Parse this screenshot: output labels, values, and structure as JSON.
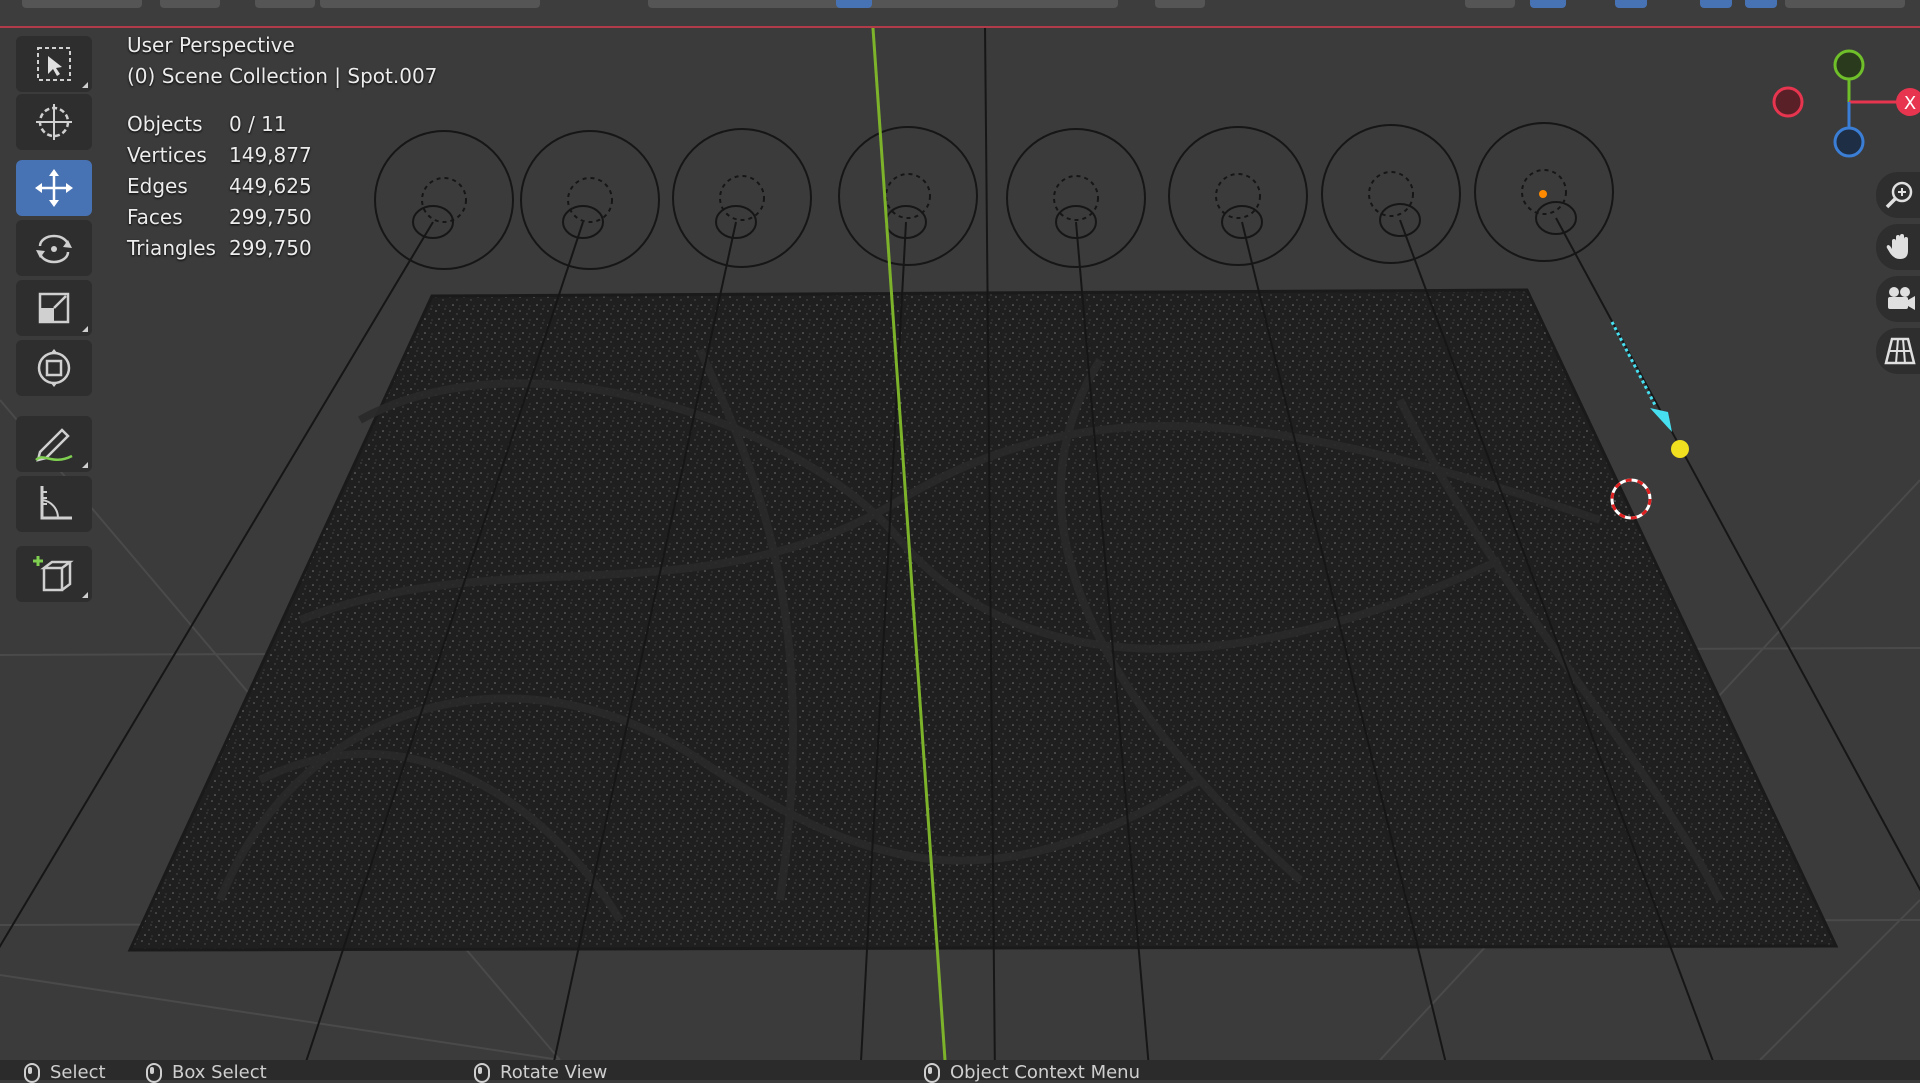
{
  "viewport": {
    "view_name": "User Perspective",
    "collection_info": "(0) Scene Collection | Spot.007"
  },
  "stats": [
    {
      "label": "Objects",
      "value": "0 / 11"
    },
    {
      "label": "Vertices",
      "value": "149,877"
    },
    {
      "label": "Edges",
      "value": "449,625"
    },
    {
      "label": "Faces",
      "value": "299,750"
    },
    {
      "label": "Triangles",
      "value": "299,750"
    }
  ],
  "toolbar": {
    "tools": [
      "select-box",
      "cursor",
      "move",
      "rotate",
      "scale",
      "transform",
      "annotate",
      "measure",
      "add-cube"
    ],
    "active_tool": "move"
  },
  "gizmo": {
    "axis_x_label": "X",
    "colors": {
      "x": "#e8354f",
      "y": "#6fbf2a",
      "z": "#3b7ed6"
    }
  },
  "nav_buttons": [
    "zoom-icon",
    "pan-hand-icon",
    "camera-icon",
    "grid-perspective-icon"
  ],
  "statusbar": {
    "select": "Select",
    "box_select": "Box Select",
    "rotate_view": "Rotate View",
    "context_menu": "Object Context Menu"
  },
  "colors": {
    "background": "#3b3b3b",
    "active_tool": "#4772b3",
    "z_axis_line": "#7cb32a",
    "light_selected": "#47e0f0"
  }
}
